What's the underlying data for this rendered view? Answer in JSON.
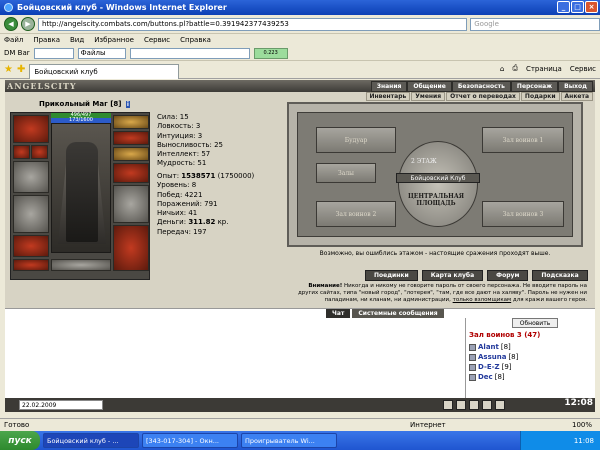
{
  "window": {
    "title": "Бойцовский клуб - Windows Internet Explorer"
  },
  "address": {
    "url": "http://angelscity.combats.com/buttons.pl?battle=0.391942377439253",
    "search_placeholder": "Google"
  },
  "menu": {
    "items": [
      "Файл",
      "Правка",
      "Вид",
      "Избранное",
      "Сервис",
      "Справка"
    ]
  },
  "dmbar": {
    "label": "DM Bar",
    "files_label": "Файлы",
    "indicator": "0.223"
  },
  "tab": {
    "title": "Бойцовский клуб",
    "page_label": "Страница",
    "service_label": "Сервис"
  },
  "game": {
    "logo": "ANGELSCITY",
    "nav": [
      "Знания",
      "Общение",
      "Безопасность",
      "Персонаж",
      "Выход"
    ],
    "subnav": [
      "Инвентарь",
      "Умения",
      "Отчет о переводах",
      "Подарки",
      "Анкета"
    ],
    "char": {
      "name": "Прикольный Маг",
      "level": "[8]",
      "hp": "496/497",
      "mp": "173/1600",
      "stats": [
        "Сила: 15",
        "Ловкость: 3",
        "Интуиция: 3",
        "Выносливость: 25",
        "Интеллект: 57",
        "Мудрость: 51"
      ],
      "exp_label": "Опыт:",
      "exp_value": "1538571",
      "exp_next": "(1750000)",
      "stats2": [
        "Уровень: 8",
        "Побед: 4221",
        "Поражений: 791",
        "Ничьих: 41"
      ],
      "money_label": "Деньги:",
      "money_value": "311.82",
      "money_unit": "кр.",
      "transfers": "Передач: 197"
    },
    "map": {
      "rooms": [
        "Будуар",
        "Зал воинов 1",
        "Залы",
        "Зал воинов 2",
        "Зал воинов 3"
      ],
      "floor": "2 ЭТАЖ",
      "club": "Бойцовский Клуб",
      "square": "ЦЕНТРАЛЬНАЯ ПЛОЩАДЬ",
      "caption": "Возможно, вы ошиблись этажом - настоящие сражения проходят выше."
    },
    "buttons": [
      "Поединки",
      "Карта клуба",
      "Форум",
      "Подсказка"
    ],
    "warn": {
      "bold": "Внимание!",
      "text1": " Никогда и никому не говорите пароль от своего персонажа. Не вводите пароль на других сайтах, типа \"новый город\", \"лотерея\", \"там, где все дают на халяву\". Пароль не нужен ни паладинам, ни кланам, ни администрации, ",
      "underlined": "только взломщикам",
      "text2": " для кражи вашего героя."
    }
  },
  "chat": {
    "tabs": [
      "Чат",
      "Системные сообщения"
    ],
    "room": "Зал воинов 3 (47)",
    "refresh": "Обновить",
    "players": [
      {
        "name": "Alant",
        "lvl": "[8]"
      },
      {
        "name": "Assuna",
        "lvl": "[8]"
      },
      {
        "name": "D-E-Z",
        "lvl": "[9]"
      },
      {
        "name": "Dec",
        "lvl": "[8]"
      }
    ]
  },
  "gamebar": {
    "date": "22.02.2009",
    "clock": "12:08"
  },
  "status": {
    "text": "Готово",
    "zone": "Интернет",
    "zoom": "100%"
  },
  "taskbar": {
    "start": "пуск",
    "tasks": [
      "Бойцовский клуб - ...",
      "[343-017-304] - Окн...",
      "Проигрыватель Wi..."
    ],
    "time": "11:08"
  }
}
